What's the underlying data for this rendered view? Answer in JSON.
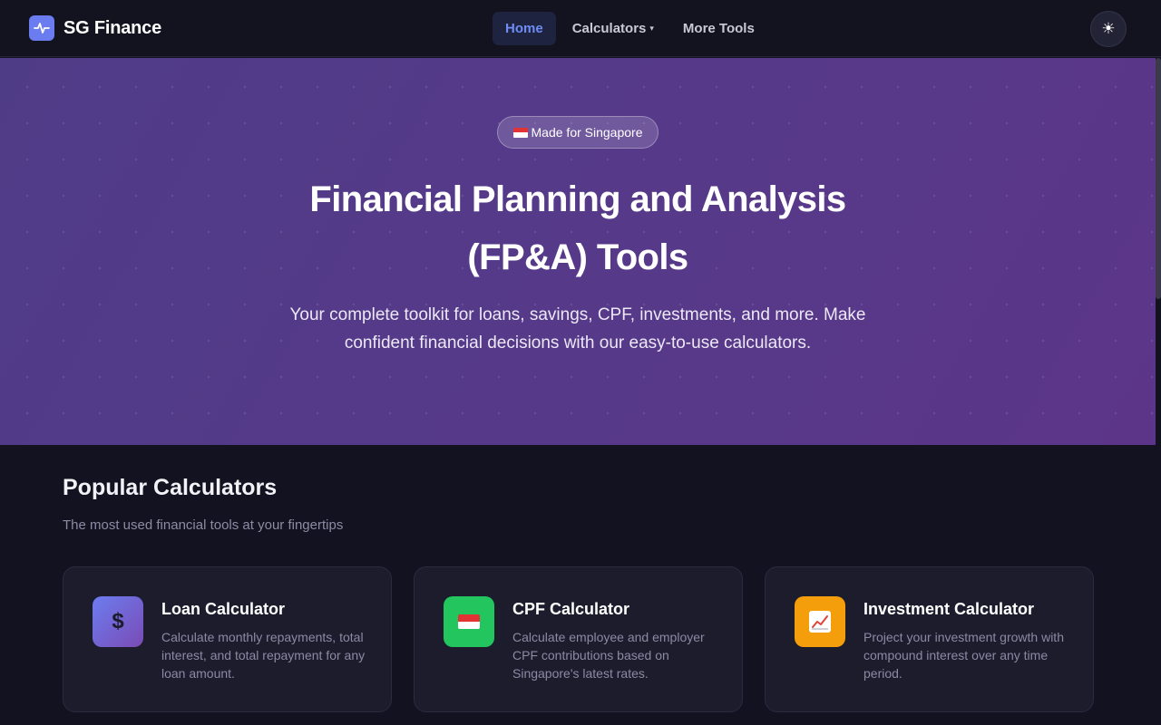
{
  "nav": {
    "brand": "SG Finance",
    "links": [
      {
        "label": "Home",
        "active": true
      },
      {
        "label": "Calculators",
        "dropdown": true
      },
      {
        "label": "More Tools"
      }
    ],
    "theme_icon": "sun-icon"
  },
  "hero": {
    "badge": "Made for Singapore",
    "badge_icon": "singapore-flag-icon",
    "title_line1": "Financial Planning and Analysis",
    "title_line2": "(FP&A) Tools",
    "subtitle_line1": "Your complete toolkit for loans, savings, CPF, investments, and more. Make",
    "subtitle_line2": "confident financial decisions with our easy-to-use calculators."
  },
  "section": {
    "title": "Popular Calculators",
    "subtitle": "The most used financial tools at your fingertips"
  },
  "cards": [
    {
      "title": "Loan Calculator",
      "desc": "Calculate monthly repayments, total interest, and total repayment for any loan amount.",
      "icon": "dollar-icon",
      "icon_glyph": "$",
      "color": "#6c7df0"
    },
    {
      "title": "CPF Calculator",
      "desc": "Calculate employee and employer CPF contributions based on Singapore's latest rates.",
      "icon": "singapore-flag-icon",
      "color": "#22c55e"
    },
    {
      "title": "Investment Calculator",
      "desc": "Project your investment growth with compound interest over any time period.",
      "icon": "chart-increasing-icon",
      "color": "#f59e0b"
    }
  ],
  "colors": {
    "accent": "#6f8cf5",
    "hero_gradient_start": "#4f3c87",
    "hero_gradient_end": "#5c3589",
    "background": "#121220"
  }
}
